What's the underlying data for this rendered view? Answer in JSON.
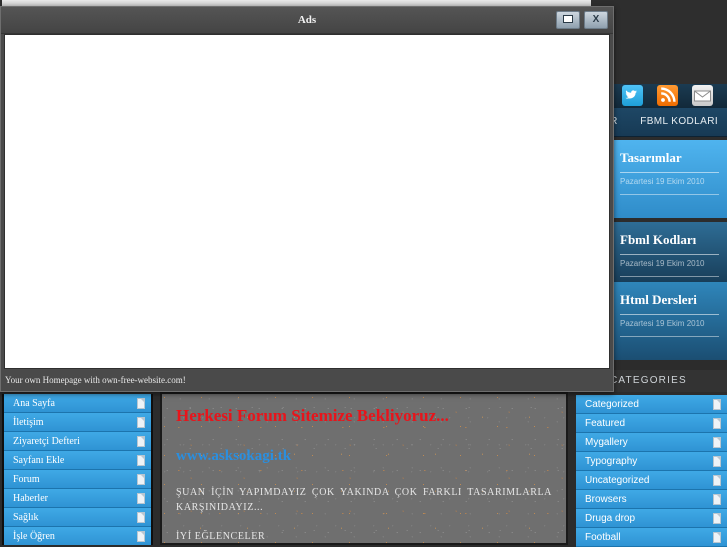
{
  "ad_window": {
    "title": "Ads",
    "maximize_label": "",
    "close_label": "X",
    "status_text": "Your own Homepage with own-free-website.com!",
    "maximize_icon": "maximize-icon",
    "close_icon": "close-icon"
  },
  "social": [
    {
      "name": "twitter-icon",
      "label": "Twitter",
      "color": "#1e9fd8"
    },
    {
      "name": "rss-icon",
      "label": "RSS",
      "color": "#ef6c00"
    },
    {
      "name": "mail-icon",
      "label": "Mail",
      "color": "#c9c9c9"
    }
  ],
  "top_nav": {
    "items": [
      {
        "label": "TASARIMLAR"
      },
      {
        "label": "FBML KODLARI"
      }
    ]
  },
  "posts": [
    {
      "title": "Tasarımlar",
      "date": "Pazartesi 19 Ekim 2010"
    },
    {
      "title": "Fbml Kodları",
      "date": "Pazartesi 19 Ekim 2010"
    },
    {
      "title": "Html Dersleri",
      "date": "Pazartesi 19 Ekim 2010"
    }
  ],
  "categories_widget": {
    "header": "CATEGORIES",
    "items": [
      {
        "label": "Categorized"
      },
      {
        "label": "Featured"
      },
      {
        "label": "Mygallery"
      },
      {
        "label": "Typography"
      },
      {
        "label": "Uncategorized"
      },
      {
        "label": "Browsers"
      },
      {
        "label": "Druga drop"
      },
      {
        "label": "Football"
      }
    ]
  },
  "left_menu": {
    "items": [
      {
        "label": "Ana Sayfa"
      },
      {
        "label": "İletişim"
      },
      {
        "label": "Ziyaretçi Defteri"
      },
      {
        "label": "Sayfanı Ekle"
      },
      {
        "label": "Forum"
      },
      {
        "label": "Haberler"
      },
      {
        "label": "Sağlık"
      },
      {
        "label": "İşle Öğren"
      }
    ]
  },
  "content": {
    "headline": "Herkesi Forum Sitemize Bekliyoruz...",
    "site_link": "www.asksokagi.tk",
    "body": "ŞUAN İÇİN YAPIMDAYIZ ÇOK YAKINDA ÇOK FARKLI TASARIMLARLA KARŞINIDAYIZ...",
    "body2": "İYİ EĞLENCELER"
  },
  "colors": {
    "accent_blue": "#3fa9e6",
    "headline_red": "#e8141b",
    "link_blue": "#2a8fe0",
    "panel_gray": "#6f6f6f",
    "dark_bg": "#2c2c2c"
  }
}
